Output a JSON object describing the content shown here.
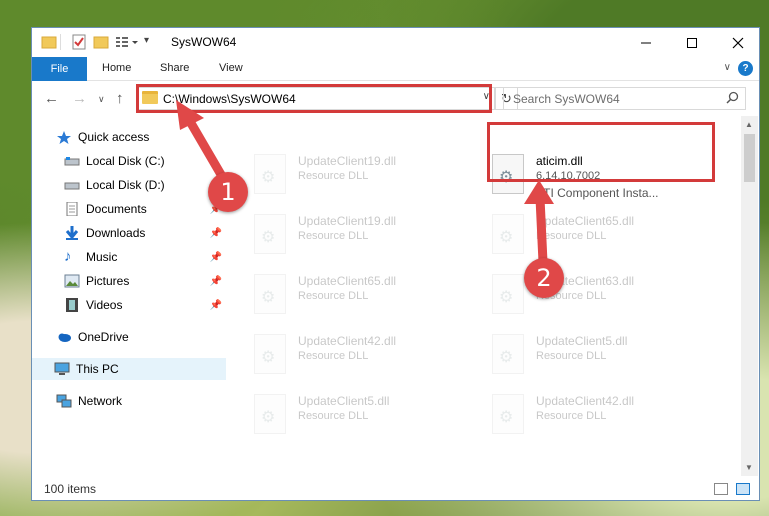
{
  "window": {
    "title": "SysWOW64"
  },
  "ribbon": {
    "tabs": [
      "File",
      "Home",
      "Share",
      "View"
    ],
    "help_label": "?"
  },
  "nav": {
    "address_path": "C:\\Windows\\SysWOW64",
    "search_placeholder": "Search SysWOW64"
  },
  "sidebar": {
    "items": [
      {
        "label": "Quick access"
      },
      {
        "label": "Local Disk (C:)"
      },
      {
        "label": "Local Disk (D:)"
      },
      {
        "label": "Documents"
      },
      {
        "label": "Downloads"
      },
      {
        "label": "Music"
      },
      {
        "label": "Pictures"
      },
      {
        "label": "Videos"
      },
      {
        "label": "OneDrive"
      },
      {
        "label": "This PC"
      },
      {
        "label": "Network"
      }
    ]
  },
  "files": [
    {
      "name": "UpdateClient19.dll",
      "type": "Resource DLL"
    },
    {
      "name": "aticim.dll",
      "version": "6.14.10.7002",
      "description": "ATI Component Insta..."
    },
    {
      "name": "UpdateClient19.dll",
      "type": "Resource DLL"
    },
    {
      "name": "UpdateClient65.dll",
      "type": "Resource DLL"
    },
    {
      "name": "UpdateClient65.dll",
      "type": "Resource DLL"
    },
    {
      "name": "UpdateClient63.dll",
      "type": "Resource DLL"
    },
    {
      "name": "UpdateClient42.dll",
      "type": "Resource DLL"
    },
    {
      "name": "UpdateClient5.dll",
      "type": "Resource DLL"
    },
    {
      "name": "UpdateClient5.dll",
      "type": "Resource DLL"
    },
    {
      "name": "UpdateClient42.dll",
      "type": "Resource DLL"
    }
  ],
  "status": {
    "item_count": "100 items"
  },
  "callouts": [
    "1",
    "2"
  ],
  "colors": {
    "accent": "#1979ca",
    "highlight": "#d33a3a",
    "callout": "#e04848"
  }
}
